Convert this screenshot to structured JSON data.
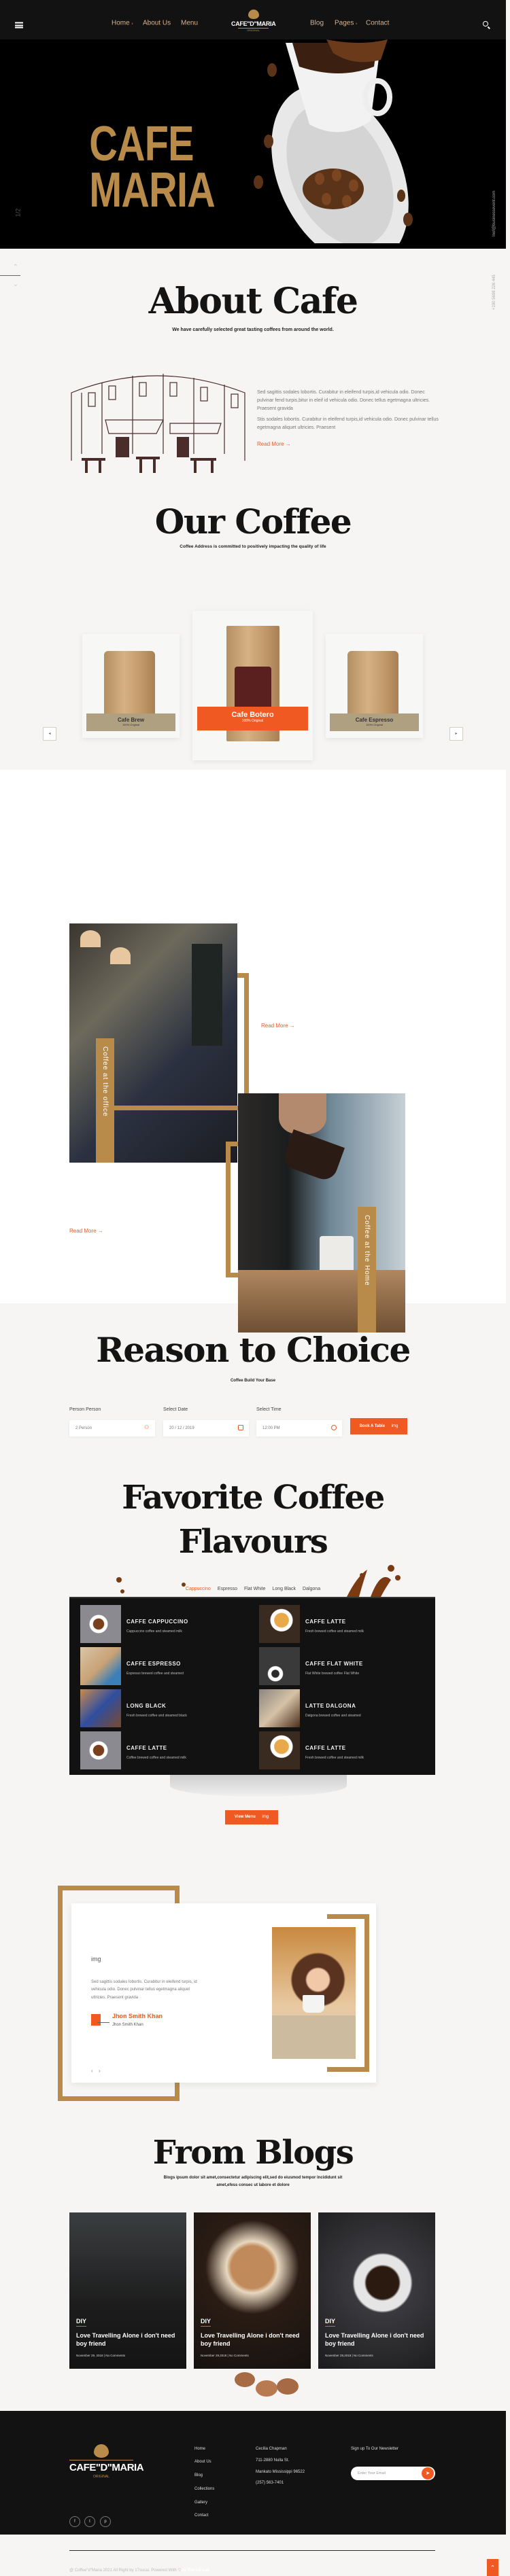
{
  "header": {
    "nav_left": [
      "Home",
      "About Us",
      "Menu"
    ],
    "nav_right": [
      "Blog",
      "Pages",
      "Contact"
    ],
    "logo_text": "CAFE\"D\"MARIA",
    "logo_sub": "ORIGINAL"
  },
  "hero": {
    "title_line1": "CAFE",
    "title_line2": "MARIA",
    "slide_counter": "1/2",
    "email": "Inof@businessevent.com",
    "phone": "+190 5698 226 445"
  },
  "about": {
    "title": "About Cafe",
    "subtitle": "We have carefully selected great tasting coffees from around the world.",
    "para1": "Sed sagittis sodales lobortis. Curabitur in eleifend turpis,id vehicula odio. Donec pulvinar fend turpis,bitur in eleif id vehicula odio. Donec tellus egetmagna ultricies. Praesent gravida",
    "para2": "Stis sodales lobortis. Curabitur in eleifend turpis,id vehicula odio. Donec pulvinar tellus egetmagna aliquet ultricies. Praesent",
    "read_more": "Read More →"
  },
  "our_coffee": {
    "title": "Our Coffee",
    "subtitle": "Coffee Address is committed to positively impacting the quality of life",
    "products": [
      {
        "name": "Cafe Brew",
        "sub": "100% Original"
      },
      {
        "name": "Cafe Botero",
        "sub": "100% Original"
      },
      {
        "name": "Cafe Espresso",
        "sub": "100% Original"
      }
    ],
    "prev": "◂",
    "next": "▸"
  },
  "features": [
    {
      "tag": "Coffee at the office",
      "read_more": "Read More →"
    },
    {
      "tag": "Coffee at the Home",
      "read_more": "Read More →"
    }
  ],
  "booking": {
    "title": "Reason to Choice",
    "subtitle": "Coffee Build Your Base",
    "person_label": "Person Person",
    "person_value": "2 Person",
    "date_label": "Select Date",
    "date_value": "20 / 12 / 2019",
    "time_label": "Select Time",
    "time_value": "12:00 PM",
    "button": "Book A Table",
    "button_img_alt": "img"
  },
  "menu": {
    "title_line1": "Favorite Coffee",
    "title_line2": "Flavours",
    "tabs": [
      "Cappuccino",
      "Espresso",
      "Flat White",
      "Long Black",
      "Dalgona"
    ],
    "active_tab": "Cappuccino",
    "items": [
      {
        "name": "CAFFE CAPPUCCINO",
        "desc": "Cappuccino coffee and steamed milk"
      },
      {
        "name": "CAFFE LATTE",
        "desc": "Fresh brewed coffee and steamed milk"
      },
      {
        "name": "CAFFE ESPRESSO",
        "desc": "Espresso brewed coffee and steamed"
      },
      {
        "name": "CAFFE FLAT WHITE",
        "desc": "Flat White brewed coffee Flat White"
      },
      {
        "name": "LONG BLACK",
        "desc": "Fresh brewed coffee and steamed black"
      },
      {
        "name": "LATTE DALGONA",
        "desc": "Dalgona brewed coffee and steamed"
      },
      {
        "name": "CAFFE LATTE",
        "desc": "Coffee brewed coffee and steamed milk"
      },
      {
        "name": "CAFFE LATTE",
        "desc": "Fresh brewed coffee and steamed milk"
      }
    ],
    "button": "View Menu",
    "button_img_alt": "img"
  },
  "testimonial": {
    "img_alt": "img",
    "text": "Sed sagittis sodales lobortis. Curabitur in eleifend turpis, id vehicula odio. Donec pulvinar tellus egetmagna aliquet ultricies. Praesent gravida",
    "name": "Jhon Smith Khan",
    "role": "Jhon Smith Khan",
    "prev": "‹",
    "next": "›"
  },
  "blogs": {
    "title": "From Blogs",
    "subtitle_line1": "Blogs ipsum dolor sit amet,consectetur adipiscing elit,sed do eiusmod tempor incididunt sit",
    "subtitle_line2": "amet,efess consec ut labore et dolore",
    "posts": [
      {
        "tag": "DIY",
        "title": "Love Travelling Alone i don't need boy friend",
        "meta": "November 29, 2018 | No Comments"
      },
      {
        "tag": "DIY",
        "title": "Love Travelling Alone i don't need boy friend",
        "meta": "November 29,2018 | No Comments"
      },
      {
        "tag": "DIY",
        "title": "Love Travelling Alone i don't need boy friend",
        "meta": "November 29,2018 | No Comments"
      }
    ]
  },
  "footer": {
    "logo_text": "CAFE\"D\"MARIA",
    "logo_sub": "ORIGINAL",
    "links": [
      "Home",
      "About Us",
      "Blog",
      "Collections",
      "Gallery",
      "Contact"
    ],
    "address": [
      "Cecilia Chapman",
      "711-2880 Nulla St.",
      "Mankato Mississippi 96522",
      "(257) 563-7401"
    ],
    "newsletter_title": "Sign up To Our Newsletter",
    "email_placeholder": "Enter Your Email",
    "social": [
      "f",
      "t",
      "p"
    ],
    "copyright": "@ Coffee\"d\"Maria 2021 All Right by 17sucai. Powered With",
    "credit": "by The UX Lab"
  },
  "colors": {
    "gold": "#b88b4a",
    "orange": "#f05a22",
    "dark": "#121212",
    "card_tan": "#b0a082"
  }
}
